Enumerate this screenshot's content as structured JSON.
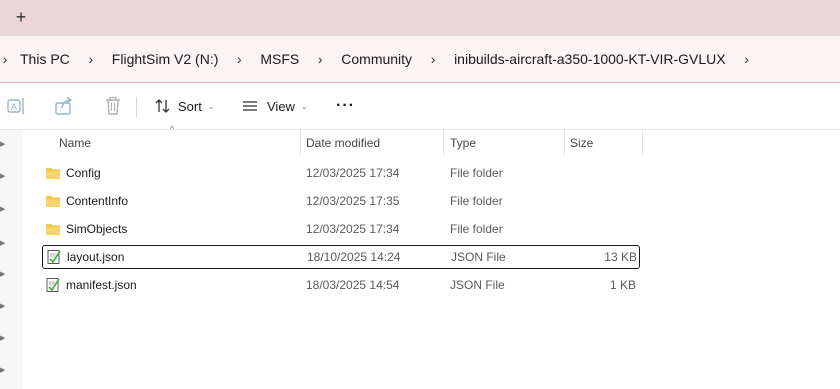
{
  "tabbar": {
    "new_tab_glyph": "+"
  },
  "breadcrumb": {
    "separator": "›",
    "items": [
      "This PC",
      "FlightSim V2 (N:)",
      "MSFS",
      "Community",
      "inibuilds-aircraft-a350-1000-KT-VIR-GVLUX"
    ]
  },
  "toolbar": {
    "sort_label": "Sort",
    "view_label": "View",
    "more_label": "···",
    "chevron": "⌄"
  },
  "columns": {
    "name": "Name",
    "date_modified": "Date modified",
    "type": "Type",
    "size": "Size",
    "sort_indicator": "^"
  },
  "files": [
    {
      "icon": "folder-icon",
      "name": "Config",
      "date": "12/03/2025 17:34",
      "type": "File folder",
      "size": ""
    },
    {
      "icon": "folder-icon",
      "name": "ContentInfo",
      "date": "12/03/2025 17:35",
      "type": "File folder",
      "size": ""
    },
    {
      "icon": "folder-icon",
      "name": "SimObjects",
      "date": "12/03/2025 17:34",
      "type": "File folder",
      "size": ""
    },
    {
      "icon": "json-file-icon",
      "name": "layout.json",
      "date": "18/10/2025 14:24",
      "type": "JSON File",
      "size": "13 KB",
      "selected": true
    },
    {
      "icon": "json-file-icon",
      "name": "manifest.json",
      "date": "18/03/2025 14:54",
      "type": "JSON File",
      "size": "1 KB"
    }
  ],
  "colors": {
    "tabbar_bg": "#ead6da",
    "address_bg": "#fbf4f5",
    "folder_yellow": "#f6c343"
  }
}
